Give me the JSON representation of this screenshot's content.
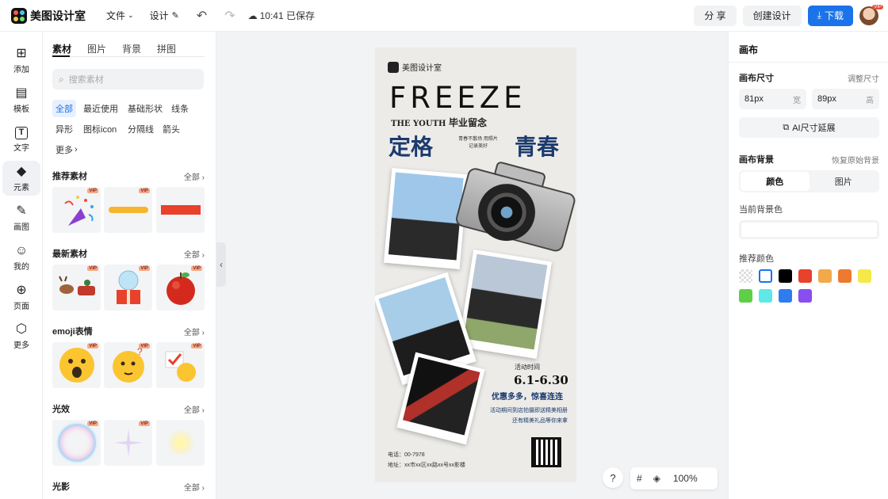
{
  "app": {
    "name": "美图设计室"
  },
  "topbar": {
    "file_menu": "文件",
    "design_menu": "设计",
    "saved_status": "10:41 已保存",
    "share": "分 享",
    "create_design": "创建设计",
    "download": "下载"
  },
  "rail": [
    {
      "label": "添加",
      "icon": "plus-square-icon",
      "glyph": "⊞"
    },
    {
      "label": "模板",
      "icon": "template-icon",
      "glyph": "▤"
    },
    {
      "label": "文字",
      "icon": "text-icon",
      "glyph": "T"
    },
    {
      "label": "元素",
      "icon": "shapes-icon",
      "glyph": "◆"
    },
    {
      "label": "画图",
      "icon": "pen-icon",
      "glyph": "✎"
    },
    {
      "label": "我的",
      "icon": "user-icon",
      "glyph": "☺"
    },
    {
      "label": "页面",
      "icon": "add-page-icon",
      "glyph": "⊕"
    },
    {
      "label": "更多",
      "icon": "cube-icon",
      "glyph": "⬡"
    }
  ],
  "panel": {
    "tabs": [
      "素材",
      "图片",
      "背景",
      "拼图"
    ],
    "search_placeholder": "搜索素材",
    "chips": [
      "全部",
      "最近使用",
      "基础形状",
      "线条",
      "异形",
      "图标icon",
      "分隔线",
      "箭头",
      "更多"
    ],
    "all_label": "全部",
    "vip_label": "VIP",
    "sections": [
      {
        "title": "推荐素材"
      },
      {
        "title": "最新素材"
      },
      {
        "title": "emoji表情"
      },
      {
        "title": "光效"
      },
      {
        "title": "光影"
      }
    ]
  },
  "poster": {
    "brand": "美图设计室",
    "headline": "FREEZE",
    "subline": "THE YOUTH",
    "subline_cn": "毕业留念",
    "word_left": "定格",
    "word_right": "青春",
    "mid_text": "青春不散场 用照片记录美好",
    "date_title": "活动时间",
    "date": "6.1-6.30",
    "promo": "优惠多多，惊喜连连",
    "info_1": "活动期间到店拍摄即送精美相册",
    "info_2": "还有精美礼品等你来拿",
    "phone": "电话：00-7978",
    "address": "地址：xx市xx区xx路xx号xx影楼"
  },
  "canvas_controls": {
    "help": "?",
    "zoom": "100%"
  },
  "rpanel": {
    "title": "画布",
    "size_label": "画布尺寸",
    "resize_link": "调整尺寸",
    "width_value": "81px",
    "width_unit": "宽",
    "height_value": "89px",
    "height_unit": "高",
    "ai_extend": "AI尺寸延展",
    "bg_label": "画布背景",
    "restore_link": "恢复原始背景",
    "seg_color": "颜色",
    "seg_image": "图片",
    "current_bg": "当前背景色",
    "recommended": "推荐颜色",
    "swatches": [
      "transparent",
      "#ffffff",
      "#000000",
      "#e8412c",
      "#f2a94a",
      "#ee7a30",
      "#f5e94a",
      "#5fcf48",
      "#5fe8e8",
      "#2f7cf0",
      "#8a4df0"
    ]
  }
}
